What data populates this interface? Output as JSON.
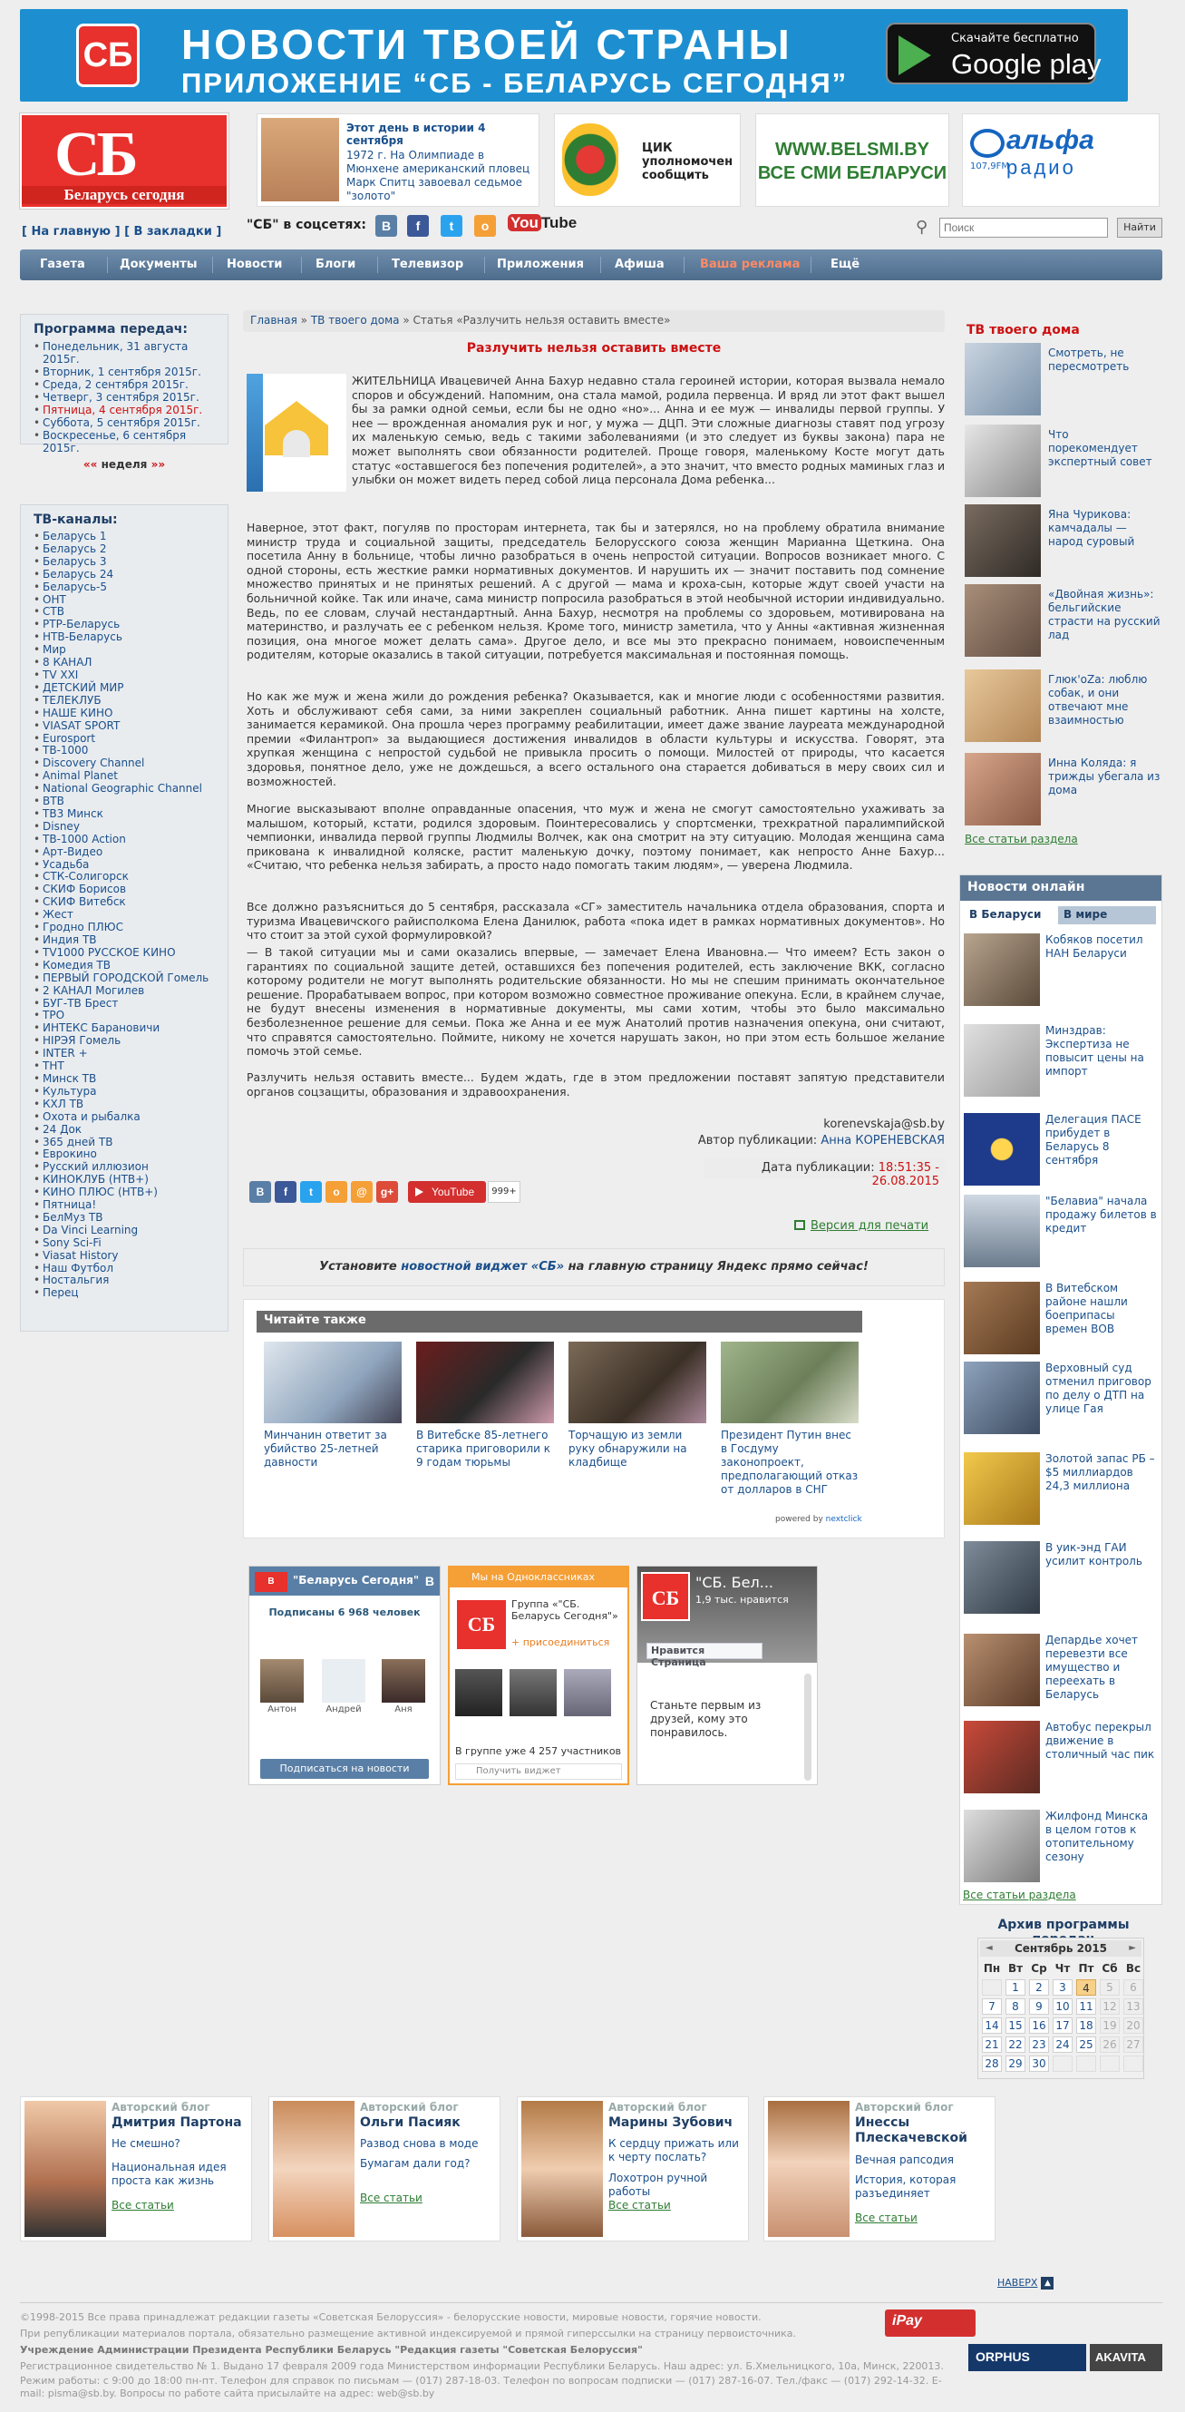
{
  "banner": {
    "logo": "СБ",
    "line1": "НОВОСТИ ТВОЕЙ СТРАНЫ",
    "line2": "ПРИЛОЖЕНИЕ “СБ - БЕЛАРУСЬ СЕГОДНЯ”",
    "gplay_small": "Скачайте бесплатно",
    "gplay_big": "Google play"
  },
  "header": {
    "logo_big": "СБ",
    "logo_small": "Беларусь сегодня",
    "history_title": "Этот день в истории 4 сентября",
    "history_text": "1972 г. На Олимпиаде в Мюнхене американский пловец Марк Спитц завоевал седьмое \"золото\"",
    "cik_text": "ЦИК уполномочен сообщить",
    "belsmi_1": "WWW.BELSMI.BY",
    "belsmi_2": "ВСЕ СМИ БЕЛАРУСИ",
    "radio_1": "альфа",
    "radio_2": "радио",
    "radio_freq": "107,9FM"
  },
  "topnav": {
    "home": "[ На главную ]",
    "bookmarks": "[ В закладки ]",
    "social_label": "\"СБ\" в соцсетях:",
    "youtube": "You",
    "youtube2": "Tube",
    "search_placeholder": "Поиск",
    "search_button": "Найти"
  },
  "menu": [
    "Газета",
    "Документы",
    "Новости",
    "Блоги",
    "Телевизор",
    "Приложения",
    "Афиша",
    "Ваша реклама",
    "Ещё"
  ],
  "colors": {
    "menu_bg": "#5d7b9b",
    "accent_red": "#c11111",
    "link": "#1a4f8b",
    "green": "#2e7d32"
  },
  "program": {
    "title": "Программа передач:",
    "items": [
      "Понедельник, 31 августа 2015г.",
      "Вторник, 1 сентября 2015г.",
      "Среда, 2 сентября 2015г.",
      "Четверг, 3 сентября 2015г.",
      "Пятница, 4 сентября 2015г.",
      "Суббота, 5 сентября 2015г.",
      "Воскресенье, 6 сентября 2015г."
    ],
    "prev": "««",
    "week": "неделя",
    "next": "»»"
  },
  "channels": {
    "title": "ТВ-каналы:",
    "items": [
      "Беларусь 1",
      "Беларусь 2",
      "Беларусь 3",
      "Беларусь 24",
      "Беларусь-5",
      "ОНТ",
      "СТВ",
      "РТР-Беларусь",
      "НТВ-Беларусь",
      "Мир",
      "8 КАНАЛ",
      "TV XXI",
      "ДЕТСКИЙ МИР",
      "ТЕЛЕКЛУБ",
      "НАШЕ КИНО",
      "VIASAT SPORT",
      "Eurosport",
      "ТВ-1000",
      "Discovery Channel",
      "Animal Planet",
      "National Geographic Channel",
      "ВТВ",
      "ТВ3 Минск",
      "Disney",
      "ТВ-1000 Action",
      "Арт-Видео",
      "Усадьба",
      "СТК-Солигорск",
      "СКИФ Борисов",
      "СКИФ Витебск",
      "Жест",
      "Гродно ПЛЮС",
      "Индия ТВ",
      "TV1000 РУССКОЕ КИНО",
      "Комедия ТВ",
      "ПЕРВЫЙ ГОРОДСКОЙ Гомель",
      "2 КАНАЛ Могилев",
      "БУГ-ТВ Брест",
      "ТРО",
      "ИНТЕКС Барановичи",
      "НІРЭЯ Гомель",
      "INTER +",
      "ТНТ",
      "Минск ТВ",
      "Культура",
      "КХЛ ТВ",
      "Охота и рыбалка",
      "24 Док",
      "365 дней ТВ",
      "Еврокино",
      "Русский иллюзион",
      "КИНОКЛУБ (НТВ+)",
      "КИНО ПЛЮС (НТВ+)",
      "Пятница!",
      "БелМуз ТВ",
      "Da Vinci Learning",
      "Sony Sci-Fi",
      "Viasat History",
      "Наш Футбол",
      "Ностальгия",
      "Перец"
    ]
  },
  "article": {
    "breadcrumb_home": "Главная",
    "breadcrumb_sep": "»",
    "breadcrumb_section": "ТВ твоего дома",
    "breadcrumb_current": "Статья «Разлучить нельзя оставить вместе»",
    "title": "Разлучить нельзя оставить вместе",
    "p1": "ЖИТЕЛЬНИЦА Ивацевичей Анна Бахур недавно стала героиней истории, которая вызвала немало споров и обсуждений. Напомним, она стала мамой, родила первенца. И вряд ли этот факт вышел бы за рамки одной семьи, если бы не одно «но»... Анна и ее муж — инвалиды первой группы. У нее — врожденная аномалия рук и ног, у мужа — ДЦП. Эти сложные диагнозы ставят под угрозу их маленькую семью, ведь с такими заболеваниями (и это следует из буквы закона) пара не может выполнять свои обязанности родителей. Проще говоря, маленькому Косте могут дать статус «оставшегося без попечения родителей», а это значит, что вместо родных маминых глаз и улыбки он может видеть перед собой лица персонала Дома ребенка...",
    "p2": "Наверное, этот факт, погуляв по просторам интернета, так бы и затерялся, но на проблему обратила внимание министр труда и социальной защиты, председатель Белорусского союза женщин Марианна Щеткина. Она посетила Анну в больнице, чтобы лично разобраться в очень непростой ситуации. Вопросов возникает много. С одной стороны, есть жесткие рамки нормативных документов. И нарушить их — значит поставить под сомнение множество принятых и не принятых решений. А с другой — мама и кроха-сын, которые ждут своей участи на больничной койке. Так или иначе, сама министр попросила разобраться в этой необычной истории индивидуально. Ведь, по ее словам, случай нестандартный. Анна Бахур, несмотря на проблемы со здоровьем, мотивирована на материнство, и разлучать ее с ребенком нельзя. Кроме того, министр заметила, что у Анны «активная жизненная позиция, она многое может делать сама». Другое дело, и все мы это прекрасно понимаем, новоиспеченным родителям, которые оказались в такой ситуации, потребуется максимальная и постоянная помощь.",
    "p3": "Но как же муж и жена жили до рождения ребенка? Оказывается, как и многие люди с особенностями развития. Хоть и обслуживают себя сами, за ними закреплен социальный работник. Анна пишет картины на холсте, занимается керамикой. Она прошла через программу реабилитации, имеет даже звание лауреата международной премии «Филантроп» за выдающиеся достижения инвалидов в области культуры и искусства. Говорят, эта хрупкая женщина с непростой судьбой не привыкла просить о помощи. Милостей от природы, что касается здоровья, понятное дело, уже не дождешься, а всего остального она старается добиваться в меру своих сил и возможностей.",
    "p4": "Многие высказывают вполне оправданные опасения, что муж и жена не смогут самостоятельно ухаживать за малышом, который, кстати, родился здоровым. Поинтересовались у спортсменки, трехкратной паралимпийской чемпионки, инвалида первой группы Людмилы Волчек, как она смотрит на эту ситуацию. Молодая женщина сама прикована к инвалидной коляске, растит маленькую дочку, поэтому понимает, как непросто Анне Бахур... «Считаю, что ребенка нельзя забирать, а просто надо помогать таким людям», — уверена Людмила.",
    "p5": "Все должно разъясниться до 5 сентября, рассказала «СГ» заместитель начальника отдела образования, спорта и туризма Ивацевичского райисполкома Елена Данилюк, работа «пока идет в рамках нормативных документов». Но что стоит за этой сухой формулировкой?",
    "p6": "— В такой ситуации мы и сами оказались впервые, — замечает Елена Ивановна.— Что имеем? Есть закон о гарантиях по социальной защите детей, оставшихся без попечения родителей, есть заключение ВКК, согласно которому родители не могут выполнять родительские обязанности. Но мы не спешим принимать окончательное решение. Прорабатываем вопрос, при котором возможно совместное проживание опекуна. Если, в крайнем случае, не будут внесены изменения в нормативные документы, мы сами хотим, чтобы это было максимально безболезненное решение для семьи. Пока же Анна и ее муж Анатолий против назначения опекуна, они считают, что справятся самостоятельно. Поймите, никому не хочется нарушать закон, но при этом есть большое желание помочь этой семье.",
    "p7": "Разлучить нельзя оставить вместе... Будем ждать, где в этом предложении поставят запятую представители органов соцзащиты, образования и здравоохранения.",
    "email": "korenevskaja@sb.by",
    "author_label": "Автор публикации:",
    "author": "Анна КОРЕНЕВСКАЯ",
    "date_label": "Дата публикации:",
    "date": "18:51:35 - 26.08.2015",
    "yt_share": "YouTube",
    "yt_count": "999+",
    "print": "Версия для печати",
    "widget_pre": "Установите ",
    "widget_link": "новостной виджет «СБ»",
    "widget_post": " на главную страницу Яндекс прямо сейчас!"
  },
  "read_also": {
    "title": "Читайте также",
    "items": [
      "Минчанин ответит за убийство 25-летней давности",
      "В Витебске 85-летнего старика приговорили к 9 годам тюрьмы",
      "Торчащую из земли руку обнаружили на кладбище",
      "Президент Путин внес в Госдуму законопроект, предполагающий отказ от долларов в СНГ"
    ],
    "powered": "powered by ",
    "powered_brand": "nextclick"
  },
  "vk": {
    "title": "\"Беларусь Сегодня\"",
    "subscribed": "Подписаны 6 968 человек",
    "users": [
      "Антон",
      "Андрей",
      "Аня"
    ],
    "button": "Подписаться на новости",
    "logo": "В"
  },
  "ok": {
    "header": "Мы на Одноклассниках",
    "group": "Группа «\"СБ. Беларусь Сегодня\"»",
    "join": "+ присоединиться",
    "members": "В группе уже 4 257 участников",
    "get_widget": "Получить виджет",
    "logo": "СБ"
  },
  "fb": {
    "name": "\"СБ. Бел...",
    "likes": "1,9 тыс. нравится",
    "like_btn": "Нравится Страница",
    "friends": "Станьте первым из друзей, кому это понравилось.",
    "logo": "СБ"
  },
  "tv_home": {
    "title": "ТВ твоего дома",
    "items": [
      "Смотреть, не пересмотреть",
      "Что порекомендует экспертный совет",
      "Яна Чурикова: камчадалы — народ суровый",
      "«Двойная жизнь»: бельгийские страсти на русский лад",
      "Глюк'oZa: люблю собак, и они отвечают мне взаимностью",
      "Инна Коляда: я трижды убегала из дома"
    ],
    "all": "Все статьи раздела"
  },
  "news_online": {
    "title": "Новости онлайн",
    "tab1": "В Беларуси",
    "tab2": "В мире",
    "items": [
      "Кобяков посетил НАН Беларуси",
      "Минздрав: Экспертиза не повысит цены на импорт",
      "Делегация ПАСЕ прибудет в Беларусь 8 сентября",
      "\"Белавиа\" начала продажу билетов в кредит",
      "В Витебском районе нашли боеприпасы времен ВОВ",
      "Верховный суд отменил приговор по делу о ДТП на улице Гая",
      "Золотой запас РБ – $5 миллиардов 24,3 миллиона",
      "В уик-энд ГАИ усилит контроль",
      "Депардье хочет перевезти все имущество и переехать в Беларусь",
      "Автобус перекрыл движение в столичный час пик",
      "Жилфонд Минска в целом готов к отопительному сезону"
    ],
    "all": "Все статьи раздела"
  },
  "archive": {
    "title": "Архив программы передач",
    "month": "Сентябрь 2015",
    "prev": "◄",
    "next": "►",
    "weekdays": [
      "Пн",
      "Вт",
      "Ср",
      "Чт",
      "Пт",
      "Сб",
      "Вс"
    ],
    "days": [
      "",
      "1",
      "2",
      "3",
      "4",
      "5",
      "6",
      "7",
      "8",
      "9",
      "10",
      "11",
      "12",
      "13",
      "14",
      "15",
      "16",
      "17",
      "18",
      "19",
      "20",
      "21",
      "22",
      "23",
      "24",
      "25",
      "26",
      "27",
      "28",
      "29",
      "30",
      "",
      "",
      "",
      ""
    ]
  },
  "blogs": [
    {
      "label": "Авторский блог",
      "name": "Дмитрия Партона",
      "q1": "Не смешно?",
      "q2": "Национальная идея проста как жизнь",
      "all": "Все статьи"
    },
    {
      "label": "Авторский блог",
      "name": "Ольги Пасияк",
      "q1": "Развод снова в моде",
      "q2": "Бумагам дали год?",
      "all": "Все статьи"
    },
    {
      "label": "Авторский блог",
      "name": "Марины Зубович",
      "q1": "К сердцу прижать или к черту послать?",
      "q2": "Лохотрон ручной работы",
      "all": "Все статьи"
    },
    {
      "label": "Авторский блог",
      "name": "Инессы Плескачевской",
      "q1": "Вечная рапсодия",
      "q2": "История, которая разъединяет",
      "all": "Все статьи"
    }
  ],
  "naverh": "НАВЕРХ",
  "naverh_icon": "▲",
  "footer": {
    "l1": "©1998-2015 Все права принадлежат редакции газеты «Советская Белоруссия» - белорусские новости, мировые новости, горячие новости.",
    "l2": "При републикации материалов портала, обязательно размещение активной индексируемой и прямой гиперссылки на страницу первоисточника.",
    "l3": "Учреждение Администрации Президента Республики Беларусь \"Редакция газеты \"Советская Белоруссия\"",
    "l4": "Регистрационное свидетельство № 1. Выдано 17 февраля 2009 года Министерством информации Республики Беларусь. Наш адрес: ул. Б.Хмельницкого, 10а, Минск, 220013.",
    "l5": "Режим работы: с 9:00 до 18:00 пн-пт. Телефон для справок по письмам — (017) 287-18-03. Телефон по вопросам подписки — (017) 287-16-07. Тел./факс — (017) 292-14-32. E-mail: pisma@sb.by. Вопросы по работе сайта присылайте на адрес: web@sb.by",
    "ipay": "iPay",
    "orphus": "ORPHUS",
    "akavita": "AKAVITA"
  }
}
